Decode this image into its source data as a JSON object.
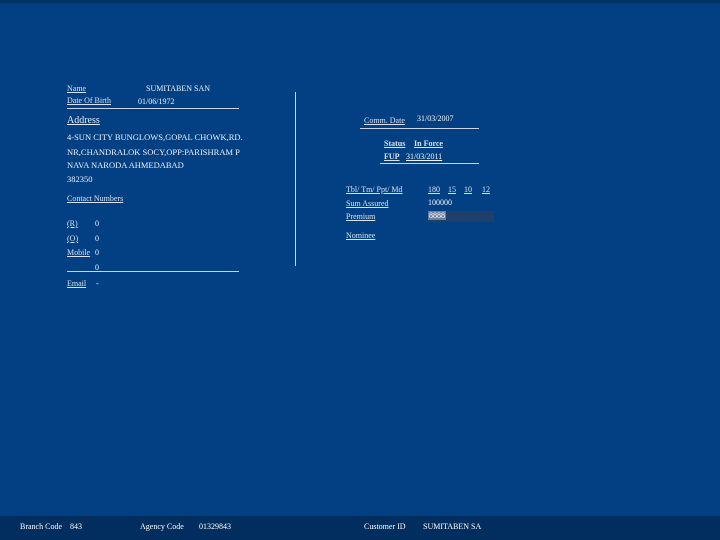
{
  "customer": {
    "name_label": "Name",
    "name_value": "SUMITABEN SAN",
    "dob_label": "Date Of Birth",
    "dob_value": "01/06/1972"
  },
  "address": {
    "heading": "Address",
    "line1": "4-SUN CITY BUNGLOWS,GOPAL CHOWK,RD.",
    "line2": "NR,CHANDRALOK SOCY,OPP:PARISHRAM P",
    "line3": "NAVA NARODA AHMEDABAD",
    "line4": "382350"
  },
  "contact": {
    "heading": "Contact Numbers",
    "r_label": "(R)",
    "r_value": "0",
    "o_label": "(O)",
    "o_value": "0",
    "mobile_label": "Mobile",
    "mobile_value": "0",
    "extra_value": "0",
    "email_label": "Email",
    "email_value": "-"
  },
  "policy": {
    "comm_date_label": "Comm. Date",
    "comm_date_value": "31/03/2007",
    "status_label": "Status",
    "status_value": "In Force",
    "fup_label": "FUP",
    "fup_value": "31/03/2011",
    "tbl_label": "Tbl/ Tm/ Ppt/ Md",
    "tbl_values": [
      "180",
      "15",
      "10",
      "12"
    ],
    "sum_assured_label": "Sum Assured",
    "sum_assured_value": "100000",
    "premium_label": "Premium",
    "premium_value": "8888",
    "nominee_label": "Nominee"
  },
  "footer": {
    "branch_label": "Branch Code",
    "branch_value": "843",
    "agency_label": "Agency Code",
    "agency_value": "01329843",
    "customer_id_label": "Customer ID",
    "customer_id_value": "SUMITABEN SA"
  },
  "colors": {
    "background": "#024083",
    "footer_bar": "#012e5f",
    "text": "#eef2f8"
  }
}
